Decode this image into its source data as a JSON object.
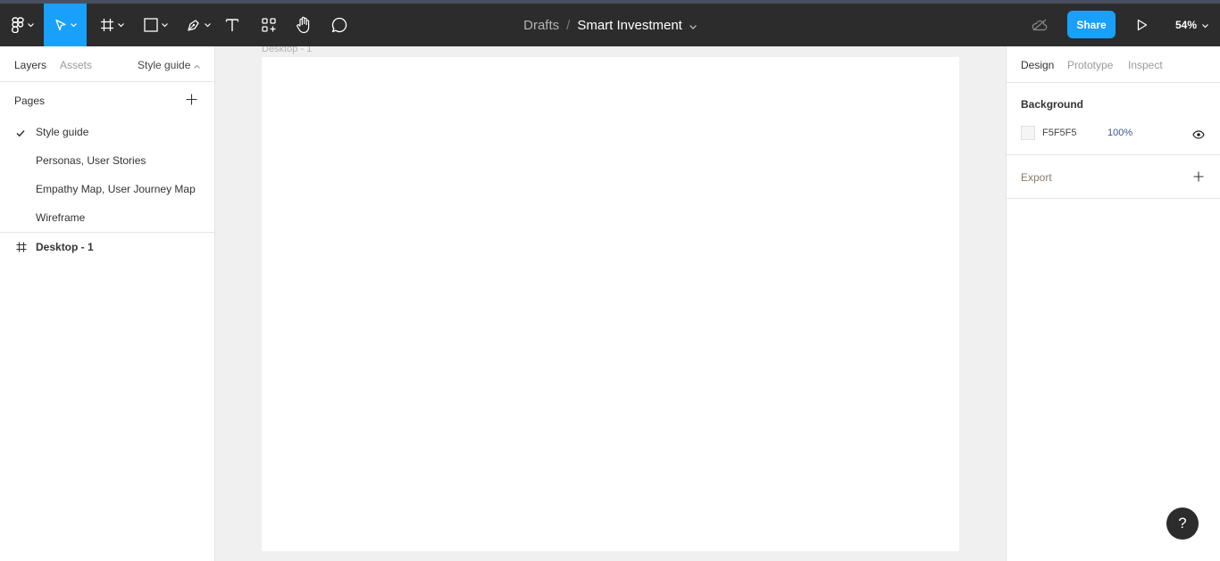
{
  "toolbar": {
    "breadcrumb_parent": "Drafts",
    "breadcrumb_separator": "/",
    "file_name": "Smart Investment",
    "share_label": "Share",
    "zoom": "54%",
    "accent_color": "#18a0fb",
    "icons": [
      "figma-menu-icon",
      "move-tool-icon",
      "frame-tool-icon",
      "shape-tool-icon",
      "pen-tool-icon",
      "text-tool-icon",
      "components-icon",
      "hand-tool-icon",
      "comment-icon",
      "offline-cloud-icon",
      "play-icon"
    ]
  },
  "left_panel": {
    "tabs": [
      "Layers",
      "Assets"
    ],
    "current_page": "Style guide",
    "pages_label": "Pages",
    "pages": [
      {
        "label": "Style guide",
        "selected": true
      },
      {
        "label": "Personas, User Stories",
        "selected": false
      },
      {
        "label": "Empathy Map, User Journey Map",
        "selected": false
      },
      {
        "label": "Wireframe",
        "selected": false
      }
    ],
    "layers": [
      {
        "label": "Desktop - 1",
        "icon": "frame-icon"
      }
    ]
  },
  "canvas": {
    "frame_label": "Desktop - 1"
  },
  "right_panel": {
    "tabs": [
      "Design",
      "Prototype",
      "Inspect"
    ],
    "background": {
      "title": "Background",
      "hex": "F5F5F5",
      "opacity": "100%",
      "color": "#F5F5F5"
    },
    "export_label": "Export"
  },
  "help_label": "?"
}
